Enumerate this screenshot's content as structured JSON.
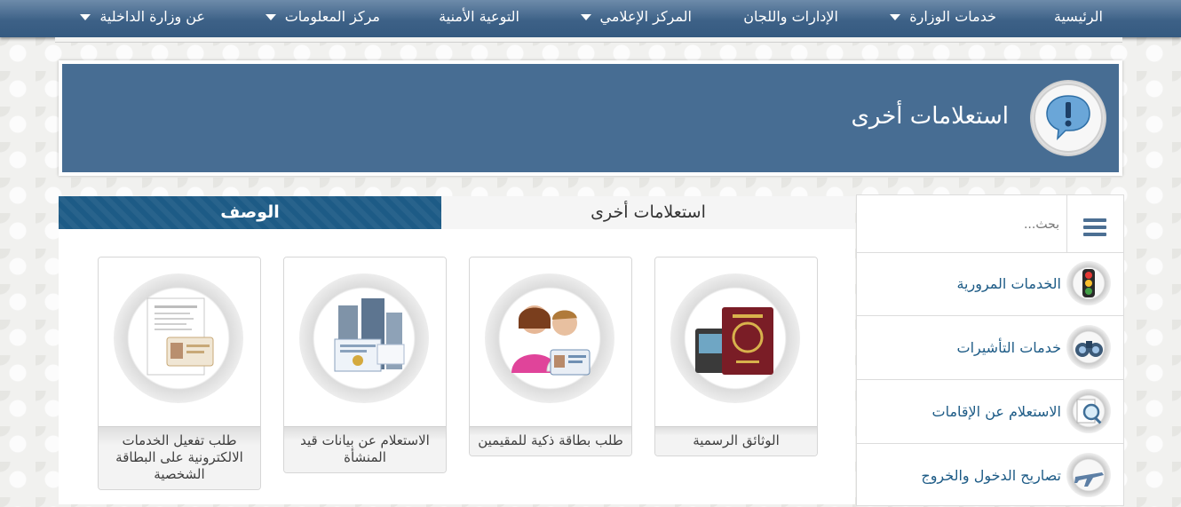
{
  "nav": {
    "items": [
      {
        "label": "الرئيسية",
        "has_dropdown": false
      },
      {
        "label": "خدمات الوزارة",
        "has_dropdown": true
      },
      {
        "label": "الإدارات واللجان",
        "has_dropdown": false
      },
      {
        "label": "المركز الإعلامي",
        "has_dropdown": true
      },
      {
        "label": "التوعية الأمنية",
        "has_dropdown": false
      },
      {
        "label": "مركز المعلومات",
        "has_dropdown": true
      },
      {
        "label": "عن وزارة الداخلية",
        "has_dropdown": true
      }
    ]
  },
  "banner": {
    "title": "استعلامات أخرى",
    "icon": "exclamation-speech-bubble-icon",
    "color": "#476d93"
  },
  "tabs": {
    "active": "الوصف",
    "other": "استعلامات أخرى",
    "active_color": "#1d5b86"
  },
  "cards": [
    {
      "title": "الوثائق الرسمية",
      "icon": "passport-documents-icon"
    },
    {
      "title": "طلب بطاقة ذكية للمقيمين",
      "icon": "smart-card-residents-icon"
    },
    {
      "title": "الاستعلام عن بيانات قيد المنشأة",
      "icon": "company-buildings-certificate-icon"
    },
    {
      "title": "طلب تفعيل الخدمات الالكترونية على البطاقة الشخصية",
      "icon": "id-card-document-icon"
    }
  ],
  "sidebar": {
    "search_placeholder": "بحث...",
    "menu_icon": "hamburger-menu-icon",
    "items": [
      {
        "label": "الخدمات المرورية",
        "icon": "traffic-light-icon"
      },
      {
        "label": "خدمات التأشيرات",
        "icon": "binoculars-icon"
      },
      {
        "label": "الاستعلام عن الإقامات",
        "icon": "magnifier-document-icon"
      },
      {
        "label": "تصاريح الدخول والخروج",
        "icon": "airplane-icon"
      }
    ]
  }
}
